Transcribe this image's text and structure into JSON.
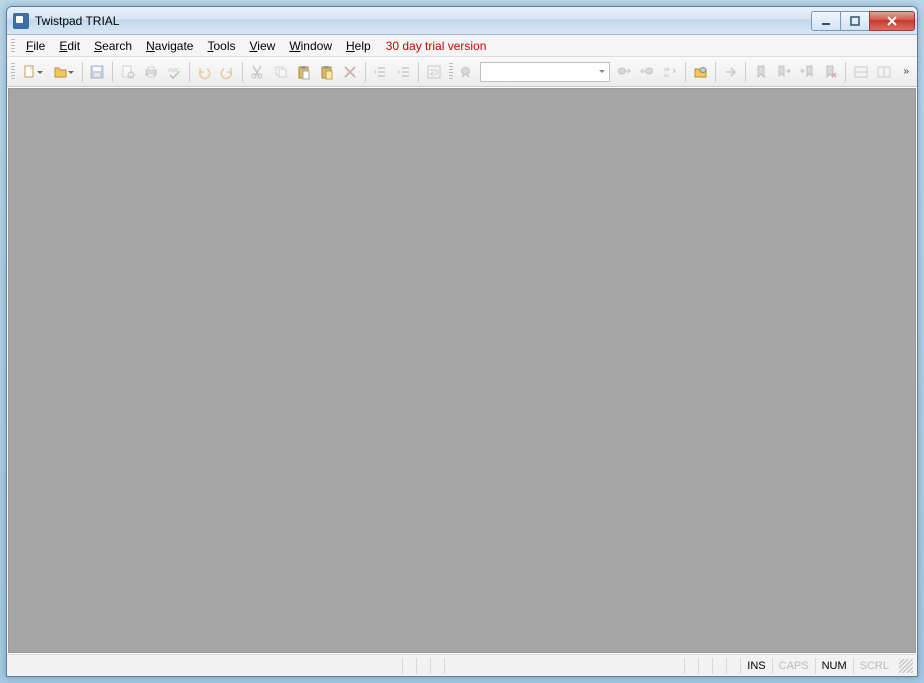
{
  "window": {
    "title": "Twistpad TRIAL"
  },
  "menu": {
    "items": [
      {
        "label": "File",
        "accel": "F"
      },
      {
        "label": "Edit",
        "accel": "E"
      },
      {
        "label": "Search",
        "accel": "S"
      },
      {
        "label": "Navigate",
        "accel": "N"
      },
      {
        "label": "Tools",
        "accel": "T"
      },
      {
        "label": "View",
        "accel": "V"
      },
      {
        "label": "Window",
        "accel": "W"
      },
      {
        "label": "Help",
        "accel": "H"
      }
    ],
    "trial_text": "30 day trial version"
  },
  "toolbar": {
    "search_value": "",
    "icons": {
      "new": "new-file-icon",
      "open": "open-folder-icon",
      "save": "save-icon",
      "preview": "print-preview-icon",
      "print": "print-icon",
      "spell": "spellcheck-icon",
      "undo": "undo-icon",
      "redo": "redo-icon",
      "cut": "cut-icon",
      "copy": "copy-icon",
      "paste": "paste-icon",
      "paste_special": "paste-special-icon",
      "delete": "delete-icon",
      "outdent": "outdent-icon",
      "indent": "indent-icon",
      "wrap": "wordwrap-icon",
      "find": "find-icon",
      "find_next": "find-next-icon",
      "find_prev": "find-prev-icon",
      "replace": "replace-icon",
      "find_files": "find-in-files-icon",
      "goto": "goto-icon",
      "bm_toggle": "bookmark-toggle-icon",
      "bm_next": "bookmark-next-icon",
      "bm_prev": "bookmark-prev-icon",
      "bm_clear": "bookmark-clear-icon",
      "split_h": "split-horizontal-icon",
      "split_v": "split-vertical-icon"
    }
  },
  "status": {
    "ins": "INS",
    "caps": "CAPS",
    "num": "NUM",
    "scrl": "SCRL"
  }
}
